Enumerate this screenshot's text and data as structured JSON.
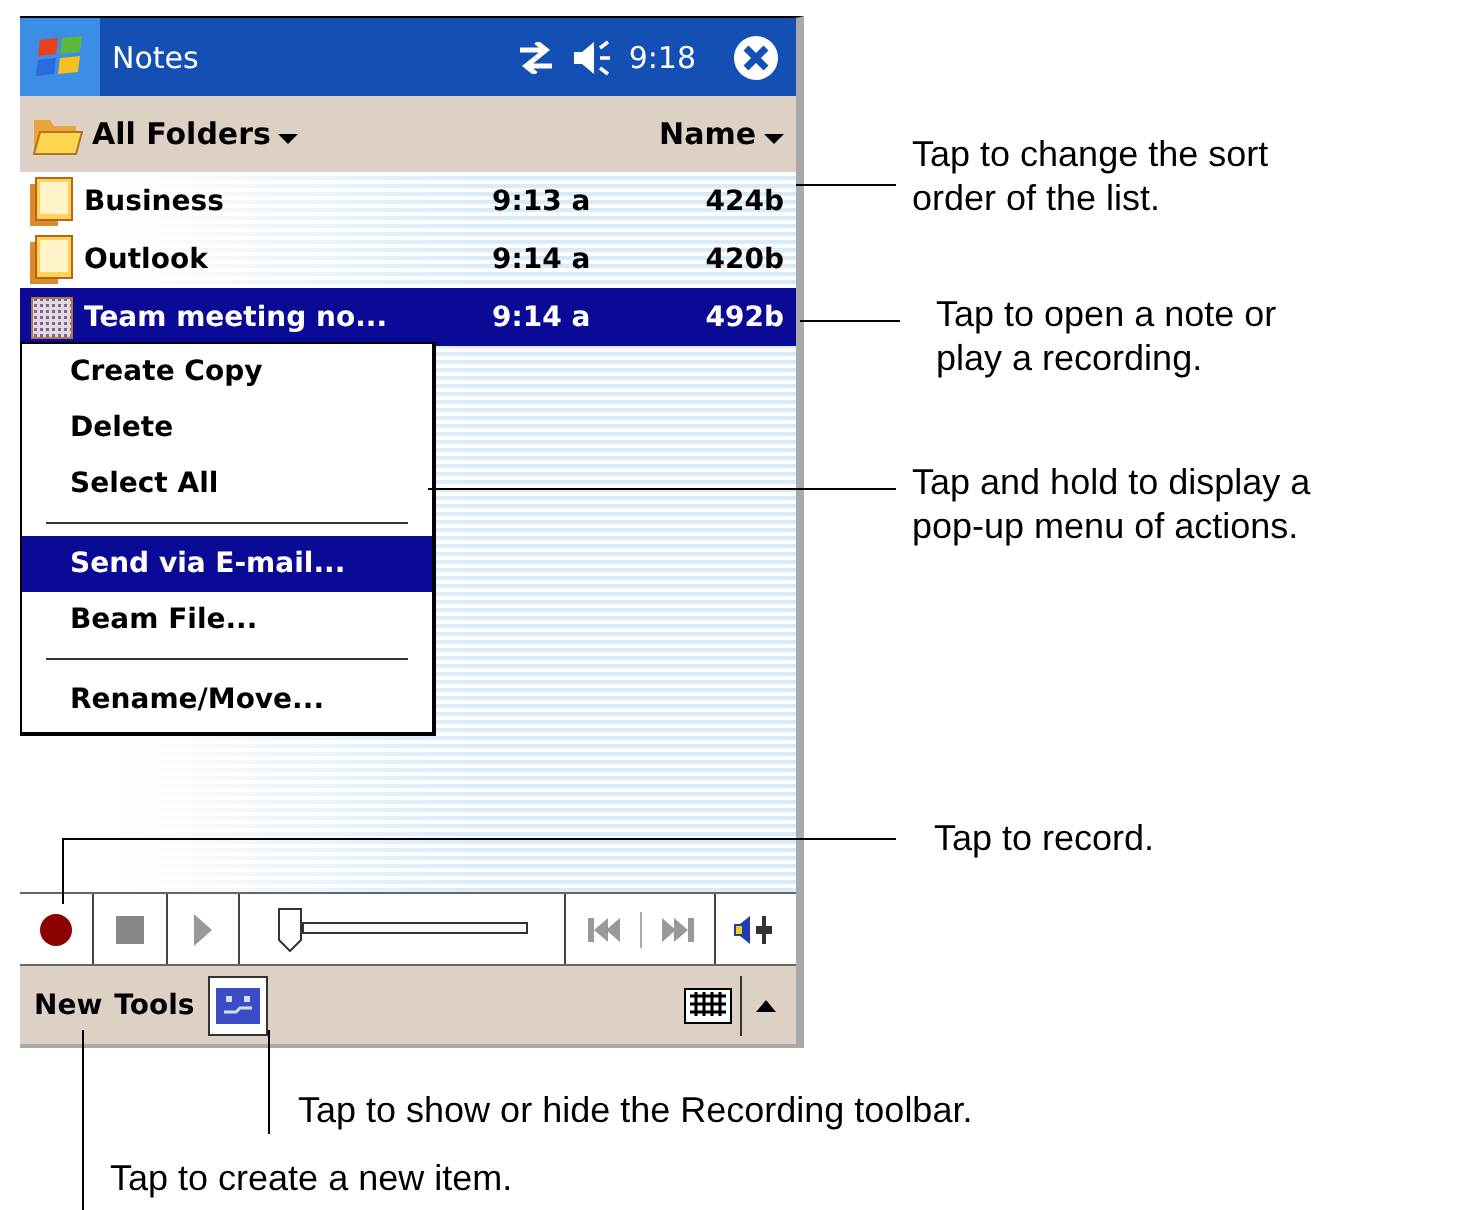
{
  "window": {
    "title": "Notes",
    "time": "9:18"
  },
  "folder_bar": {
    "folder": "All Folders",
    "sort": "Name"
  },
  "notes": [
    {
      "kind": "folder",
      "name": "Business",
      "time": "9:13 a",
      "size": "424b",
      "selected": false
    },
    {
      "kind": "folder",
      "name": "Outlook",
      "time": "9:14 a",
      "size": "420b",
      "selected": false
    },
    {
      "kind": "recording",
      "name": "Team meeting no...",
      "time": "9:14 a",
      "size": "492b",
      "selected": true
    }
  ],
  "context_menu": [
    {
      "kind": "item",
      "label": "Create Copy",
      "selected": false
    },
    {
      "kind": "item",
      "label": "Delete",
      "selected": false
    },
    {
      "kind": "item",
      "label": "Select All",
      "selected": false
    },
    {
      "kind": "separator"
    },
    {
      "kind": "item",
      "label": "Send via E-mail...",
      "selected": true
    },
    {
      "kind": "item",
      "label": "Beam File...",
      "selected": false
    },
    {
      "kind": "separator"
    },
    {
      "kind": "item",
      "label": "Rename/Move...",
      "selected": false
    }
  ],
  "recorder": {
    "level": 0
  },
  "menu_bar": {
    "items": [
      "New",
      "Tools"
    ],
    "recording_toolbar_on": true
  },
  "callouts": [
    {
      "text": "Tap to change the sort order of the list."
    },
    {
      "text": "Tap to open a note or play a recording."
    },
    {
      "text": "Tap and hold to display a pop-up menu of actions."
    },
    {
      "text": "Tap to record."
    },
    {
      "text": "Tap to show or hide the Recording toolbar."
    },
    {
      "text": "Tap to create a new item."
    }
  ]
}
